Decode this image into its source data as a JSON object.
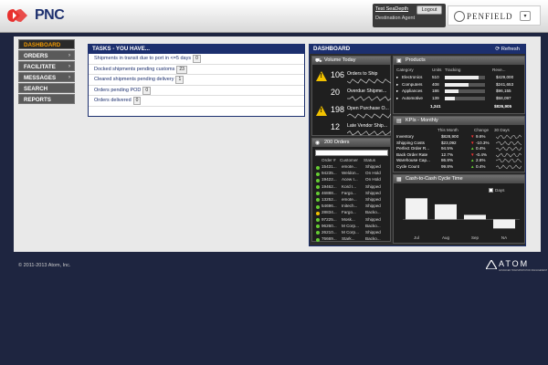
{
  "header": {
    "logo_text": "PNC",
    "user_name": "Test SeaDepth",
    "user_role": "Destination Agent",
    "logout_label": "Logout",
    "brand_name": "PENFIELD"
  },
  "nav": {
    "items": [
      {
        "label": "DASHBOARD",
        "active": true,
        "arrow": ""
      },
      {
        "label": "ORDERS",
        "active": false,
        "arrow": "›"
      },
      {
        "label": "FACILITATE",
        "active": false,
        "arrow": "›"
      },
      {
        "label": "MESSAGES",
        "active": false,
        "arrow": "›"
      },
      {
        "label": "SEARCH",
        "active": false,
        "arrow": ""
      },
      {
        "label": "REPORTS",
        "active": false,
        "arrow": ""
      }
    ]
  },
  "tasks": {
    "title": "TASKS - YOU HAVE...",
    "items": [
      {
        "label": "Shipments in transit due to port in <=5 days",
        "count": "0"
      },
      {
        "label": "Docked shipments pending customs",
        "count": "23"
      },
      {
        "label": "Cleared shipments pending delivery",
        "count": "1"
      },
      {
        "label": "Orders pending POD",
        "count": "0"
      },
      {
        "label": "Orders delivered",
        "count": "0"
      }
    ]
  },
  "dashboard": {
    "title": "DASHBOARD",
    "refresh_label": "Refresh",
    "volume": {
      "title": "Volume Today",
      "rows": [
        {
          "num": "106",
          "label": "Orders to Ship"
        },
        {
          "num": "20",
          "label": "Overdue Shipme..."
        },
        {
          "num": "198",
          "label": "Open Purchase O..."
        },
        {
          "num": "12",
          "label": "Late Vendor Ship..."
        }
      ]
    },
    "orders": {
      "title": "Orders",
      "count": "200",
      "headers": [
        "Order #",
        "Customer",
        "Status"
      ],
      "rows": [
        {
          "order": "15431...",
          "customer": "emote...",
          "status": "Shipped",
          "color": "#6c3"
        },
        {
          "order": "94235...",
          "customer": "Weldon...",
          "status": "On Hold",
          "color": "#6c3"
        },
        {
          "order": "19422...",
          "customer": "Acew I...",
          "status": "On Hold",
          "color": "#6c3"
        },
        {
          "order": "19462...",
          "customer": "Kord I...",
          "status": "Shipped",
          "color": "#6c3"
        },
        {
          "order": "46888...",
          "customer": "Fargo...",
          "status": "Shipped",
          "color": "#6c3"
        },
        {
          "order": "13252...",
          "customer": "emote...",
          "status": "Shipped",
          "color": "#6c3"
        },
        {
          "order": "54696...",
          "customer": "Initech...",
          "status": "Shipped",
          "color": "#6c3"
        },
        {
          "order": "28834...",
          "customer": "Fargo...",
          "status": "Backo...",
          "color": "#f2c200"
        },
        {
          "order": "97225...",
          "customer": "Mosk...",
          "status": "Shipped",
          "color": "#6c3"
        },
        {
          "order": "96260...",
          "customer": "M Corp...",
          "status": "Backo...",
          "color": "#6c3"
        },
        {
          "order": "26210...",
          "customer": "M Corp...",
          "status": "Shipped",
          "color": "#6c3"
        },
        {
          "order": "76669...",
          "customer": "Stark...",
          "status": "Backo...",
          "color": "#6c3"
        }
      ]
    },
    "products": {
      "title": "Products",
      "headers": [
        "Category",
        "Units",
        "Tracking",
        "Reve..."
      ],
      "rows": [
        {
          "name": "Electronics",
          "units": "510",
          "fill": 0.85,
          "rev": "$429,000"
        },
        {
          "name": "Computers",
          "units": "408",
          "fill": 0.6,
          "rev": "$241,653"
        },
        {
          "name": "Appliances",
          "units": "186",
          "fill": 0.35,
          "rev": "$96,155"
        },
        {
          "name": "Automotive",
          "units": "139",
          "fill": 0.25,
          "rev": "$58,097"
        }
      ],
      "total_units": "1,241",
      "total_rev": "$826,905"
    },
    "kpis": {
      "title": "KPIs - Monthly",
      "headers": [
        "",
        "This Month",
        "Change",
        "30 Days"
      ],
      "rows": [
        {
          "name": "Inventory",
          "val": "$828,900",
          "dir": "down",
          "chg": "9.6%"
        },
        {
          "name": "Shipping Costs",
          "val": "$23,092",
          "dir": "down",
          "chg": "-10.3%"
        },
        {
          "name": "Perfect Order R...",
          "val": "94.5%",
          "dir": "up",
          "chg": "0.4%"
        },
        {
          "name": "Back Order Rate",
          "val": "12.7%",
          "dir": "down",
          "chg": "-0.4%"
        },
        {
          "name": "Warehouse Cap...",
          "val": "86.8%",
          "dir": "up",
          "chg": "2.6%"
        },
        {
          "name": "Cycle Count",
          "val": "99.8%",
          "dir": "up",
          "chg": "0.4%"
        }
      ]
    },
    "cash": {
      "title": "Cash-to-Cash Cycle Time",
      "check_label": "Days",
      "chart_data": {
        "type": "bar",
        "categories": [
          "Jul",
          "Aug",
          "Sep",
          "NA"
        ],
        "values": [
          28,
          20,
          6,
          -12
        ],
        "ylim": [
          -14,
          32
        ]
      }
    }
  },
  "footer": {
    "copyright": "© 2011-2013 Atom, Inc.",
    "atom_logo": "ATOM",
    "atom_tagline": "ADVANCED TRANSPORTATION MANAGEMENT"
  },
  "colors": {
    "navy": "#1c2f6e",
    "active_nav": "#f29a00",
    "warn": "#f2c200",
    "bg": "#1e2540"
  }
}
